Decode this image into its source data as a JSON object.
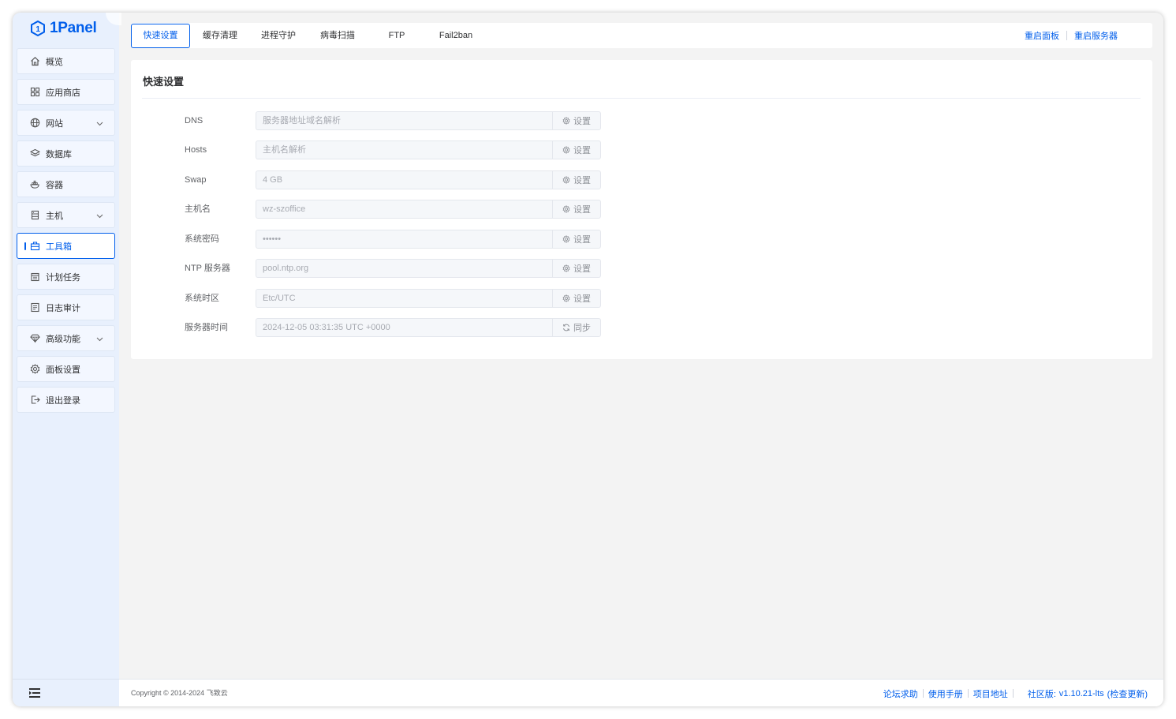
{
  "app": {
    "logo_text": "1Panel"
  },
  "sidebar": {
    "items": [
      {
        "label": "概览",
        "icon": "home-icon",
        "has_children": false,
        "active": false
      },
      {
        "label": "应用商店",
        "icon": "grid-icon",
        "has_children": false,
        "active": false
      },
      {
        "label": "网站",
        "icon": "globe-icon",
        "has_children": true,
        "active": false
      },
      {
        "label": "数据库",
        "icon": "layers-icon",
        "has_children": false,
        "active": false
      },
      {
        "label": "容器",
        "icon": "docker-icon",
        "has_children": false,
        "active": false
      },
      {
        "label": "主机",
        "icon": "server-icon",
        "has_children": true,
        "active": false
      },
      {
        "label": "工具箱",
        "icon": "toolbox-icon",
        "has_children": false,
        "active": true
      },
      {
        "label": "计划任务",
        "icon": "calendar-icon",
        "has_children": false,
        "active": false
      },
      {
        "label": "日志审计",
        "icon": "log-icon",
        "has_children": false,
        "active": false
      },
      {
        "label": "高级功能",
        "icon": "diamond-icon",
        "has_children": true,
        "active": false
      },
      {
        "label": "面板设置",
        "icon": "gear-icon",
        "has_children": false,
        "active": false
      },
      {
        "label": "退出登录",
        "icon": "logout-icon",
        "has_children": false,
        "active": false
      }
    ]
  },
  "tabs": [
    {
      "label": "快速设置",
      "active": true
    },
    {
      "label": "缓存清理",
      "active": false
    },
    {
      "label": "进程守护",
      "active": false
    },
    {
      "label": "病毒扫描",
      "active": false
    },
    {
      "label": "FTP",
      "active": false
    },
    {
      "label": "Fail2ban",
      "active": false
    }
  ],
  "top_links": {
    "restart_panel": "重启面板",
    "restart_server": "重启服务器"
  },
  "card": {
    "title": "快速设置",
    "rows": [
      {
        "label": "DNS",
        "value": "服务器地址域名解析",
        "button": "设置",
        "button_icon": "gear-icon"
      },
      {
        "label": "Hosts",
        "value": "主机名解析",
        "button": "设置",
        "button_icon": "gear-icon"
      },
      {
        "label": "Swap",
        "value": "4 GB",
        "button": "设置",
        "button_icon": "gear-icon"
      },
      {
        "label": "主机名",
        "value": "wz-szoffice",
        "button": "设置",
        "button_icon": "gear-icon"
      },
      {
        "label": "系统密码",
        "value": "••••••",
        "button": "设置",
        "button_icon": "gear-icon"
      },
      {
        "label": "NTP 服务器",
        "value": "pool.ntp.org",
        "button": "设置",
        "button_icon": "gear-icon"
      },
      {
        "label": "系统时区",
        "value": "Etc/UTC",
        "button": "设置",
        "button_icon": "gear-icon"
      },
      {
        "label": "服务器时间",
        "value": "2024-12-05 03:31:35 UTC +0000",
        "button": "同步",
        "button_icon": "sync-icon"
      }
    ]
  },
  "footer": {
    "copyright": "Copyright © 2014-2024 飞致云",
    "forum": "论坛求助",
    "manual": "使用手册",
    "project": "项目地址",
    "edition": "社区版:",
    "version": "v1.10.21-lts",
    "check_update": "(检查更新)"
  },
  "colors": {
    "accent": "#005eeb",
    "sidebar_bg": "#e8f0fd",
    "page_bg": "#f3f3f3"
  }
}
